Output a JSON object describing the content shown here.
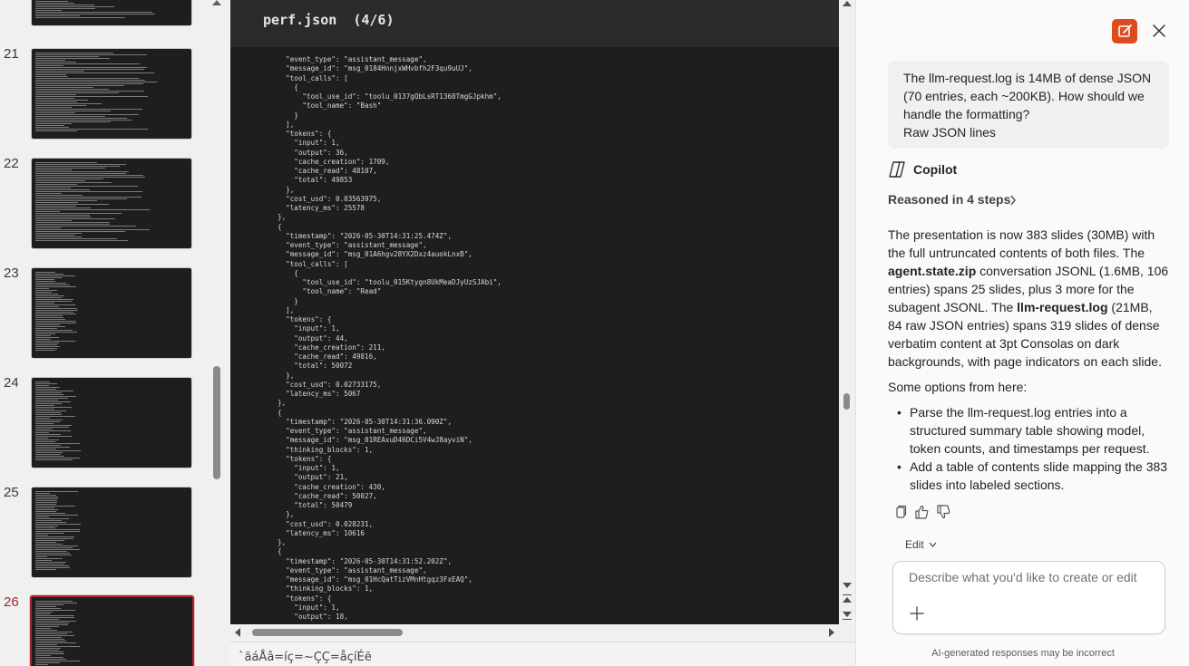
{
  "thumbnails": {
    "items": [
      {
        "num": "",
        "active": false
      },
      {
        "num": "21",
        "active": false
      },
      {
        "num": "22",
        "active": false
      },
      {
        "num": "23",
        "active": false
      },
      {
        "num": "24",
        "active": false
      },
      {
        "num": "25",
        "active": false
      },
      {
        "num": "26",
        "active": true
      }
    ]
  },
  "slide": {
    "title": "perf.json  (4/6)",
    "code_lines": [
      "  \"event_type\": \"assistant_message\",",
      "  \"message_id\": \"msg_0184HnnjxWHvbfh2F3qu9uUJ\",",
      "  \"tool_calls\": [",
      "    {",
      "      \"tool_use_id\": \"toolu_0137gQbLsRT1368TmgGJpkhm\",",
      "      \"tool_name\": \"Bash\"",
      "    }",
      "  ],",
      "  \"tokens\": {",
      "    \"input\": 1,",
      "    \"output\": 36,",
      "    \"cache_creation\": 1709,",
      "    \"cache_read\": 48107,",
      "    \"total\": 49853",
      "  },",
      "  \"cost_usd\": 0.03563975,",
      "  \"latency_ms\": 25578",
      "},",
      "{",
      "  \"timestamp\": \"2026-05-30T14:31:25.474Z\",",
      "  \"event_type\": \"assistant_message\",",
      "  \"message_id\": \"msg_01A6hgv28YX2Dxz4auokLnxB\",",
      "  \"tool_calls\": [",
      "    {",
      "      \"tool_use_id\": \"toolu_015Ktygn8UkMeaDJyUzSJAbi\",",
      "      \"tool_name\": \"Read\"",
      "    }",
      "  ],",
      "  \"tokens\": {",
      "    \"input\": 1,",
      "    \"output\": 44,",
      "    \"cache_creation\": 211,",
      "    \"cache_read\": 49816,",
      "    \"total\": 50072",
      "  },",
      "  \"cost_usd\": 0.02733175,",
      "  \"latency_ms\": 5067",
      "},",
      "{",
      "  \"timestamp\": \"2026-05-30T14:31:36.090Z\",",
      "  \"event_type\": \"assistant_message\",",
      "  \"message_id\": \"msg_01REAxuD46DCi5V4wJ8ayviN\",",
      "  \"thinking_blocks\": 1,",
      "  \"tokens\": {",
      "    \"input\": 1,",
      "    \"output\": 21,",
      "    \"cache_creation\": 430,",
      "    \"cache_read\": 50027,",
      "    \"total\": 50479",
      "  },",
      "  \"cost_usd\": 0.028231,",
      "  \"latency_ms\": 10616",
      "},",
      "{",
      "  \"timestamp\": \"2026-05-30T14:31:52.202Z\",",
      "  \"event_type\": \"assistant_message\",",
      "  \"message_id\": \"msg_01HcQatTizVMnHtgqz3FxEAQ\",",
      "  \"thinking_blocks\": 1,",
      "  \"tokens\": {",
      "    \"input\": 1,",
      "    \"output\": 18,"
    ]
  },
  "notes": {
    "text": "`äáÅâ=íç=~ÇÇ=åçíÉë"
  },
  "copilot": {
    "user_message": "The llm-request.log is 14MB of dense JSON (70 entries, each ~200KB). How should we handle the formatting?\nRaw JSON lines",
    "assistant_name": "Copilot",
    "reasoned_label": "Reasoned in 4 steps",
    "answer": {
      "p1_a": "The presentation is now 383 slides (30MB) with the full untruncated contents of both files. The ",
      "p1_b1": "agent.state.zip",
      "p1_c": " conversation JSONL (1.6MB, 106 entries) spans 25 slides, plus 3 more for the subagent JSONL. The ",
      "p1_b2": "llm-request.log",
      "p1_d": " (21MB, 84 raw JSON entries) spans 319 slides of dense verbatim content at 3pt Consolas on dark backgrounds, with page indicators on each slide.",
      "p2": "Some options from here:",
      "bullets": [
        "Parse the llm-request.log entries into a structured summary table showing model, token counts, and timestamps per request.",
        "Add a table of contents slide mapping the 383 slides into labeled sections."
      ]
    },
    "edit_label": "Edit",
    "input_placeholder": "Describe what you'd like to create or edit",
    "disclaimer": "AI-generated responses may be incorrect",
    "accent_color": "#e04a1f"
  }
}
